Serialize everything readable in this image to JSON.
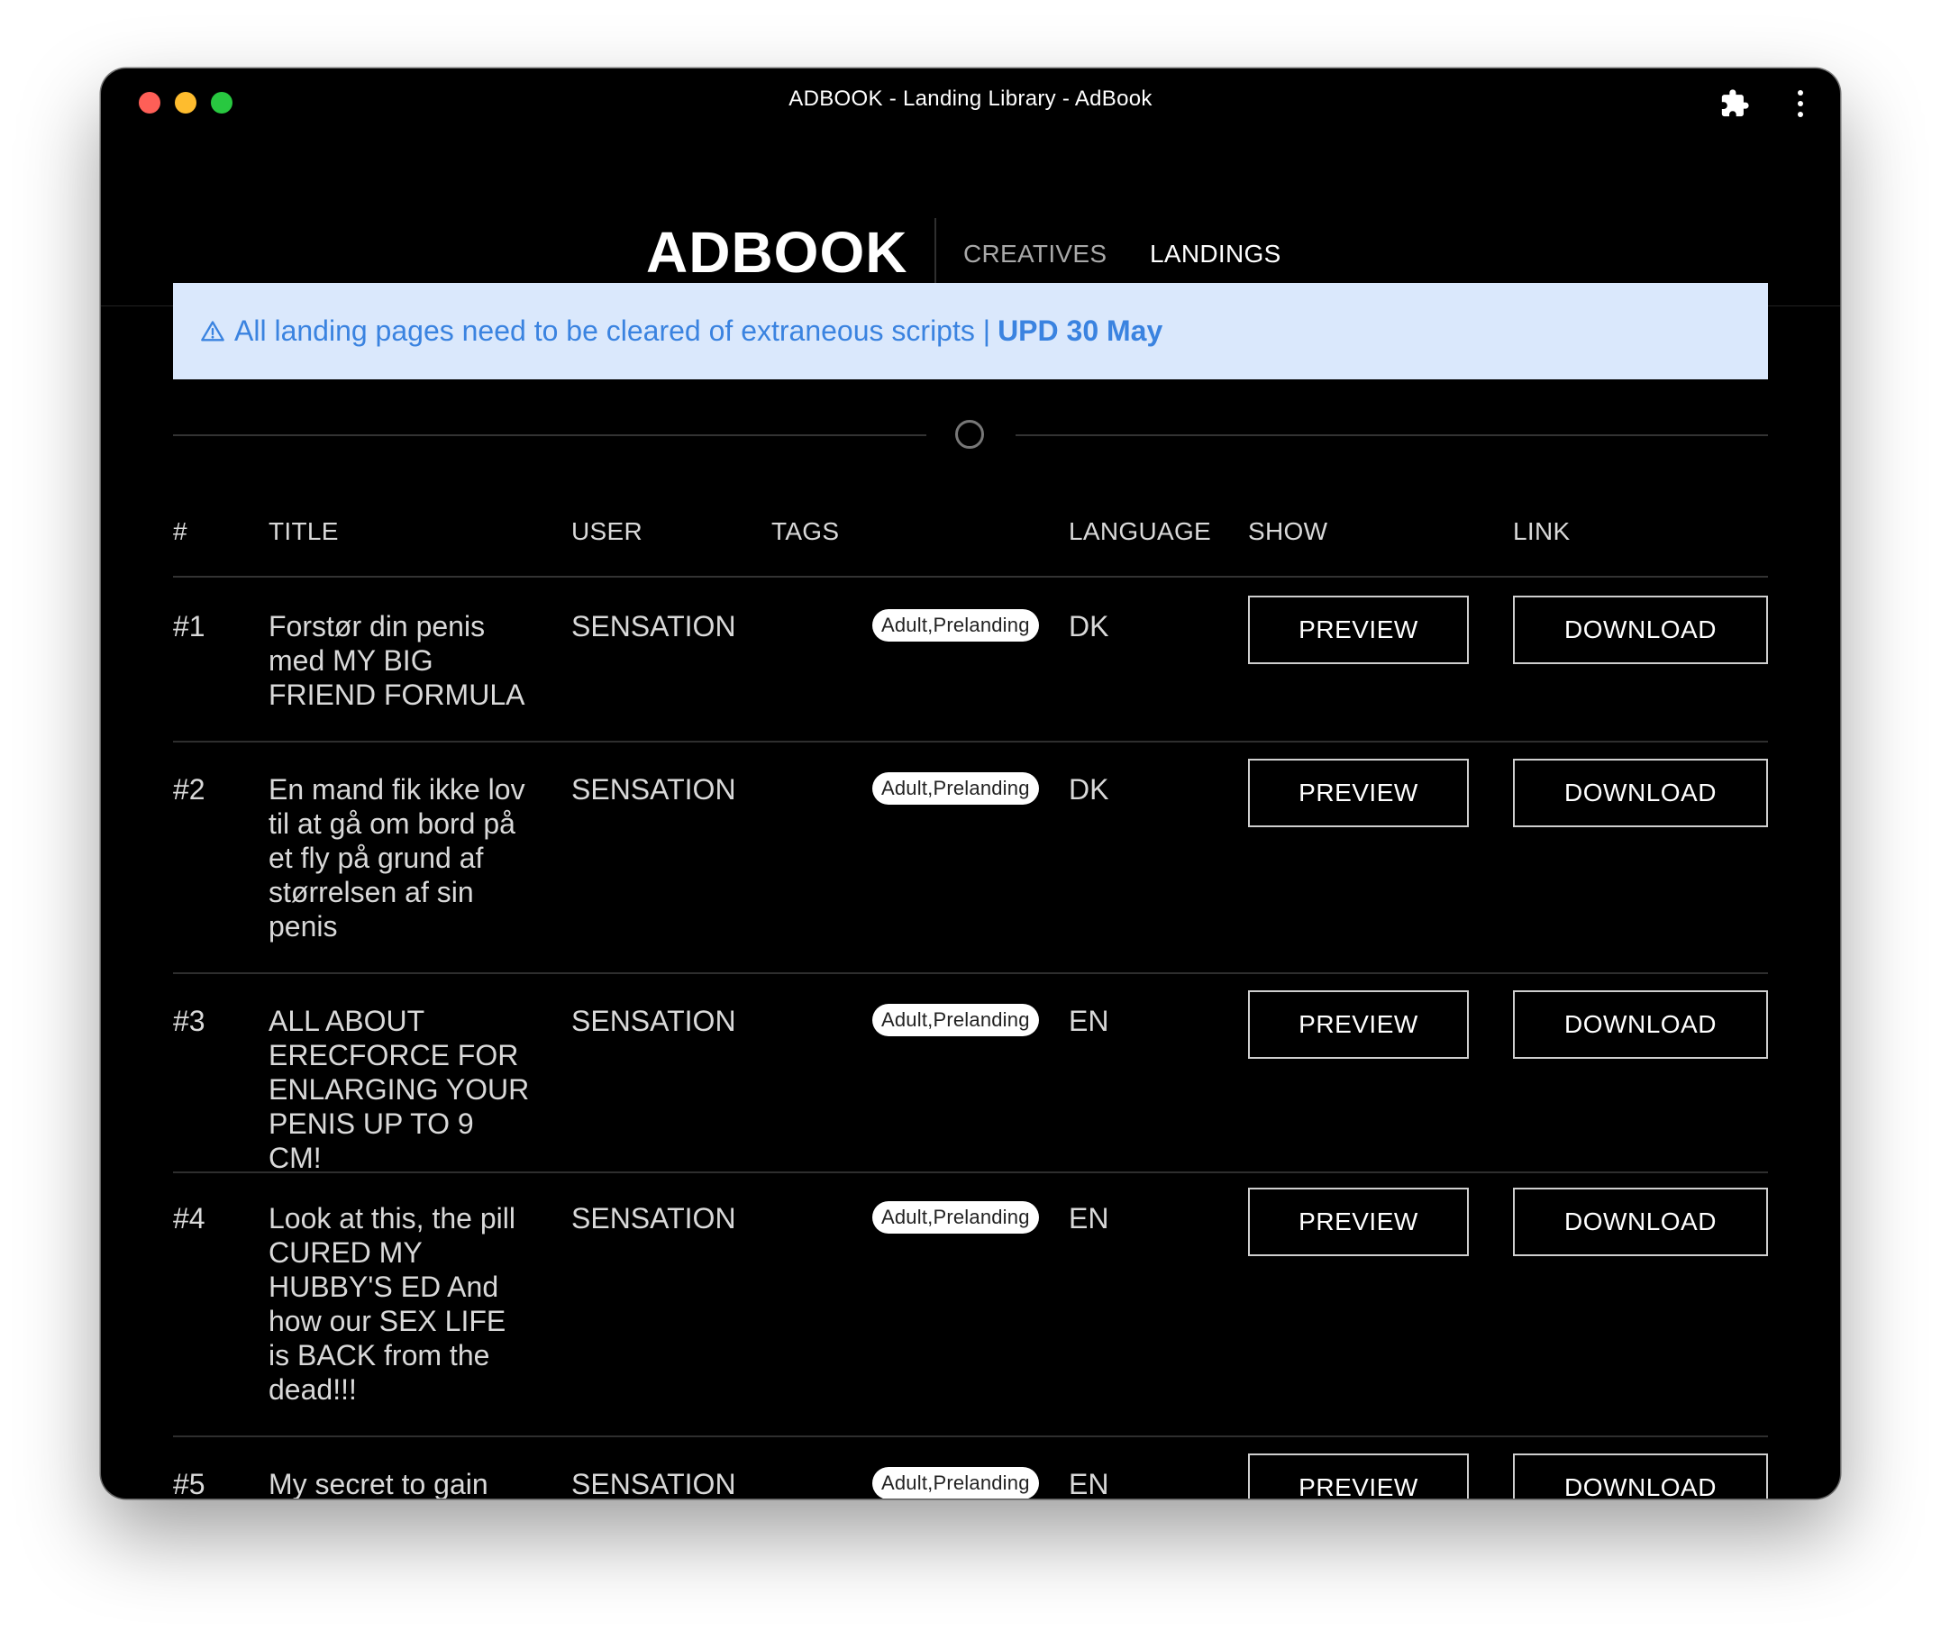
{
  "window": {
    "title": "ADBOOK - Landing Library - AdBook"
  },
  "header": {
    "logo": "ADBOOK",
    "nav": [
      {
        "label": "CREATIVES",
        "active": false
      },
      {
        "label": "LANDINGS",
        "active": true
      }
    ]
  },
  "alert": {
    "icon": "warning-triangle-icon",
    "message": "All landing pages need to be cleared of extraneous scripts |",
    "highlight": "UPD 30 May"
  },
  "table": {
    "columns": [
      "#",
      "TITLE",
      "USER",
      "TAGS",
      "LANGUAGE",
      "SHOW",
      "LINK"
    ],
    "rows": [
      {
        "num": "#1",
        "title": "Forstør din penis med MY BIG FRIEND FORMULA",
        "user": "SENSATION",
        "tags": "Adult,Prelanding",
        "language": "DK",
        "show": "PREVIEW",
        "link": "DOWNLOAD"
      },
      {
        "num": "#2",
        "title": "En mand fik ikke lov til at gå om bord på et fly på grund af størrelsen af sin penis",
        "user": "SENSATION",
        "tags": "Adult,Prelanding",
        "language": "DK",
        "show": "PREVIEW",
        "link": "DOWNLOAD"
      },
      {
        "num": "#3",
        "title": "ALL ABOUT ERECFORCE FOR ENLARGING YOUR PENIS UP TO 9 CM!",
        "user": "SENSATION",
        "tags": "Adult,Prelanding",
        "language": "EN",
        "show": "PREVIEW",
        "link": "DOWNLOAD"
      },
      {
        "num": "#4",
        "title": "Look at this, the pill CURED MY HUBBY'S ED And how our SEX LIFE is BACK from the dead!!!",
        "user": "SENSATION",
        "tags": "Adult,Prelanding",
        "language": "EN",
        "show": "PREVIEW",
        "link": "DOWNLOAD"
      },
      {
        "num": "#5",
        "title": "My secret to gain",
        "user": "SENSATION",
        "tags": "Adult,Prelanding",
        "language": "EN",
        "show": "PREVIEW",
        "link": "DOWNLOAD"
      }
    ]
  },
  "colors": {
    "background": "#000000",
    "alert_bg": "#dae8fc",
    "alert_text": "#3a83e0",
    "text": "#d9d9d9"
  }
}
